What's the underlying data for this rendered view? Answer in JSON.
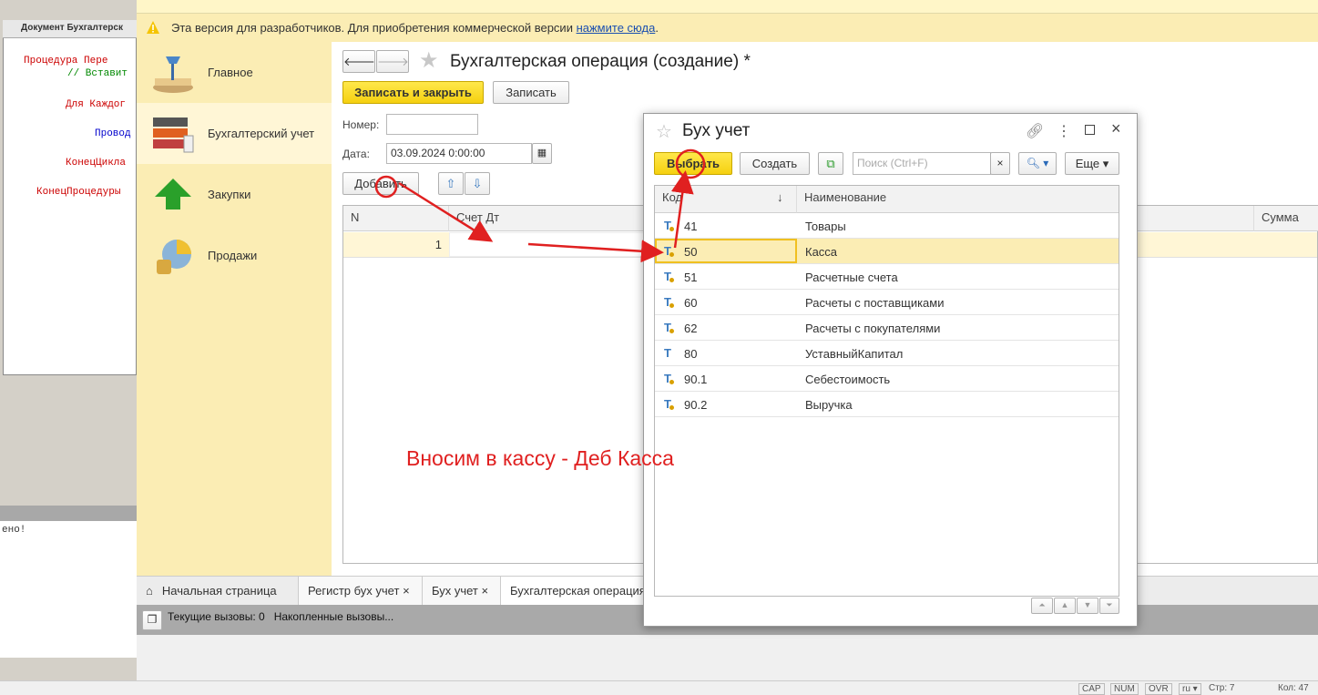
{
  "ide": {
    "title": "Документ Бухгалтерск",
    "code": [
      "Процедура Пере",
      "// Вставит",
      "Для Каждог",
      "Провод",
      "КонецЦикла",
      "КонецПроцедуры"
    ],
    "output": "ено!"
  },
  "statusbar": {
    "cap": "CAP",
    "num": "NUM",
    "ovr": "OVR",
    "lang": "ru ▾",
    "line": "Стр: 7",
    "col": "Кол: 47"
  },
  "devbar": {
    "text": "Эта версия для разработчиков. Для приобретения коммерческой версии ",
    "link": "нажмите сюда",
    "end": "."
  },
  "sidebar": {
    "items": [
      {
        "label": "Главное",
        "icon": "desk-lamp-icon"
      },
      {
        "label": "Бухгалтерский учет",
        "icon": "binders-icon"
      },
      {
        "label": "Закупки",
        "icon": "green-arrow-up-icon"
      },
      {
        "label": "Продажи",
        "icon": "coins-chart-icon"
      }
    ]
  },
  "form": {
    "title": "Бухгалтерская операция (создание) *",
    "save_close": "Записать и закрыть",
    "save": "Записать",
    "number_label": "Номер:",
    "number_value": "",
    "date_label": "Дата:",
    "date_value": "03.09.2024  0:00:00",
    "add": "Добавить",
    "columns": [
      "N",
      "Счет Дт",
      "Сумма"
    ],
    "rows": [
      {
        "n": "1"
      }
    ]
  },
  "tabs": [
    "Начальная страница",
    "Регистр бух учет",
    "Бух учет",
    "Бухгалтерская операция"
  ],
  "calls": {
    "current": "Текущие вызовы: 0",
    "accumulated": "Накопленные вызовы..."
  },
  "dialog": {
    "title": "Бух учет",
    "select": "Выбрать",
    "create": "Создать",
    "search_placeholder": "Поиск (Ctrl+F)",
    "more": "Еще ▾",
    "col_code": "Код",
    "col_name": "Наименование",
    "rows": [
      {
        "code": "41",
        "name": "Товары"
      },
      {
        "code": "50",
        "name": "Касса"
      },
      {
        "code": "51",
        "name": "Расчетные счета"
      },
      {
        "code": "60",
        "name": "Расчеты с поставщиками"
      },
      {
        "code": "62",
        "name": "Расчеты с покупателями"
      },
      {
        "code": "80",
        "name": "УставныйКапитал"
      },
      {
        "code": "90.1",
        "name": "Себестоимость"
      },
      {
        "code": "90.2",
        "name": "Выручка"
      }
    ]
  },
  "annotation": {
    "text": "Вносим в кассу - Деб Касса",
    "color": "#e02020"
  },
  "colors": {
    "accent": "#f5d010",
    "panel": "#fbedb4",
    "selected_row": "#fbedb4"
  }
}
